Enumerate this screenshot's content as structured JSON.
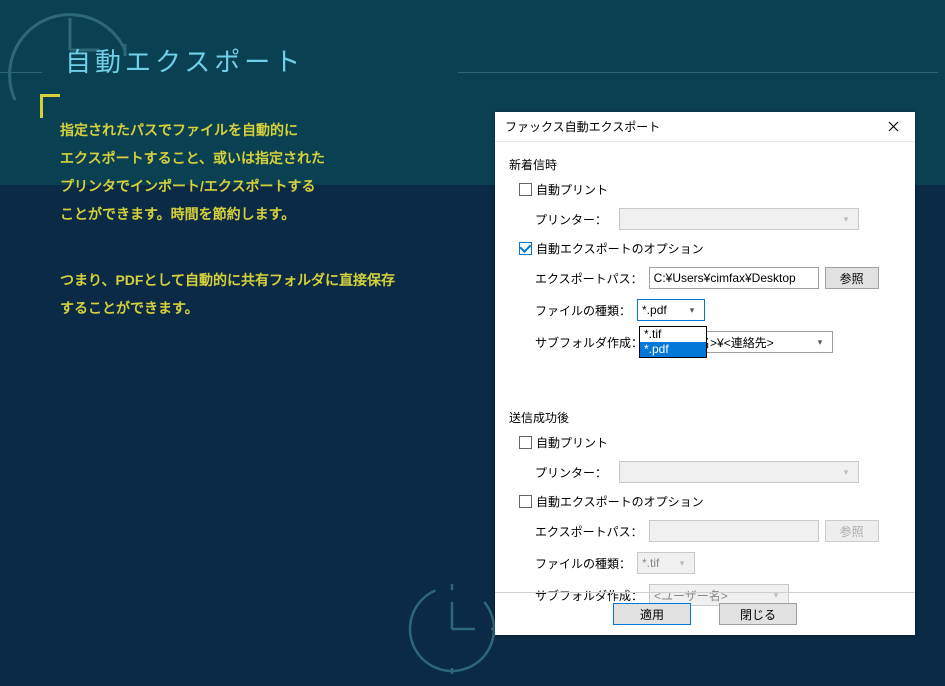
{
  "page": {
    "title": "自動エクスポート",
    "desc_l1": "指定されたパスでファイルを自動的に",
    "desc_l2": "エクスポートすること、或いは指定された",
    "desc_l3": "プリンタでインポート/エクスポートする",
    "desc_l4": "ことができます。時間を節約します。",
    "desc_l5": "つまり、PDFとして自動的に共有フォルダに直接保存",
    "desc_l6": "することができます。"
  },
  "dialog": {
    "title": "ファックス自動エクスポート",
    "incoming": {
      "group_title": "新着信時",
      "auto_print_label": "自動プリント",
      "auto_print_checked": false,
      "printer_label": "プリンター：",
      "printer_value": "",
      "auto_export_label": "自動エクスポートのオプション",
      "auto_export_checked": true,
      "export_path_label": "エクスポートパス：",
      "export_path_value": "C:¥Users¥cimfax¥Desktop",
      "browse_label": "参照",
      "filetype_label": "ファイルの種類：",
      "filetype_value": "*.pdf",
      "filetype_options": [
        "*.tif",
        "*.pdf"
      ],
      "subfolder_label": "サブフォルダ作成：",
      "subfolder_value_suffix": "名>¥<連絡先>"
    },
    "sent": {
      "group_title": "送信成功後",
      "auto_print_label": "自動プリント",
      "auto_print_checked": false,
      "printer_label": "プリンター：",
      "printer_value": "",
      "auto_export_label": "自動エクスポートのオプション",
      "auto_export_checked": false,
      "export_path_label": "エクスポートパス：",
      "export_path_value": "",
      "browse_label": "参照",
      "filetype_label": "ファイルの種類：",
      "filetype_value": "*.tif",
      "subfolder_label": "サブフォルダ作成：",
      "subfolder_value": "<ユーザー名>"
    },
    "buttons": {
      "apply": "適用",
      "close": "閉じる"
    }
  }
}
